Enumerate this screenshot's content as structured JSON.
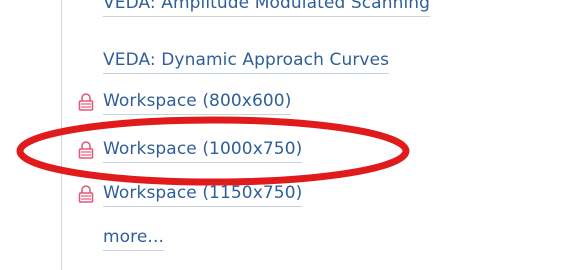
{
  "links": [
    {
      "label": "VEDA: Amplitude Modulated Scanning",
      "locked": false
    },
    {
      "label": "VEDA: Dynamic Approach Curves",
      "locked": false
    },
    {
      "label": "Workspace (800x600)",
      "locked": true
    },
    {
      "label": "Workspace (1000x750)",
      "locked": true
    },
    {
      "label": "Workspace (1150x750)",
      "locked": true
    },
    {
      "label": "more...",
      "locked": false
    }
  ],
  "colors": {
    "link": "#2f5f9a",
    "lock": "#e05a79",
    "highlight": "#e11b1b"
  },
  "icons": {
    "lock": "lock-icon"
  }
}
